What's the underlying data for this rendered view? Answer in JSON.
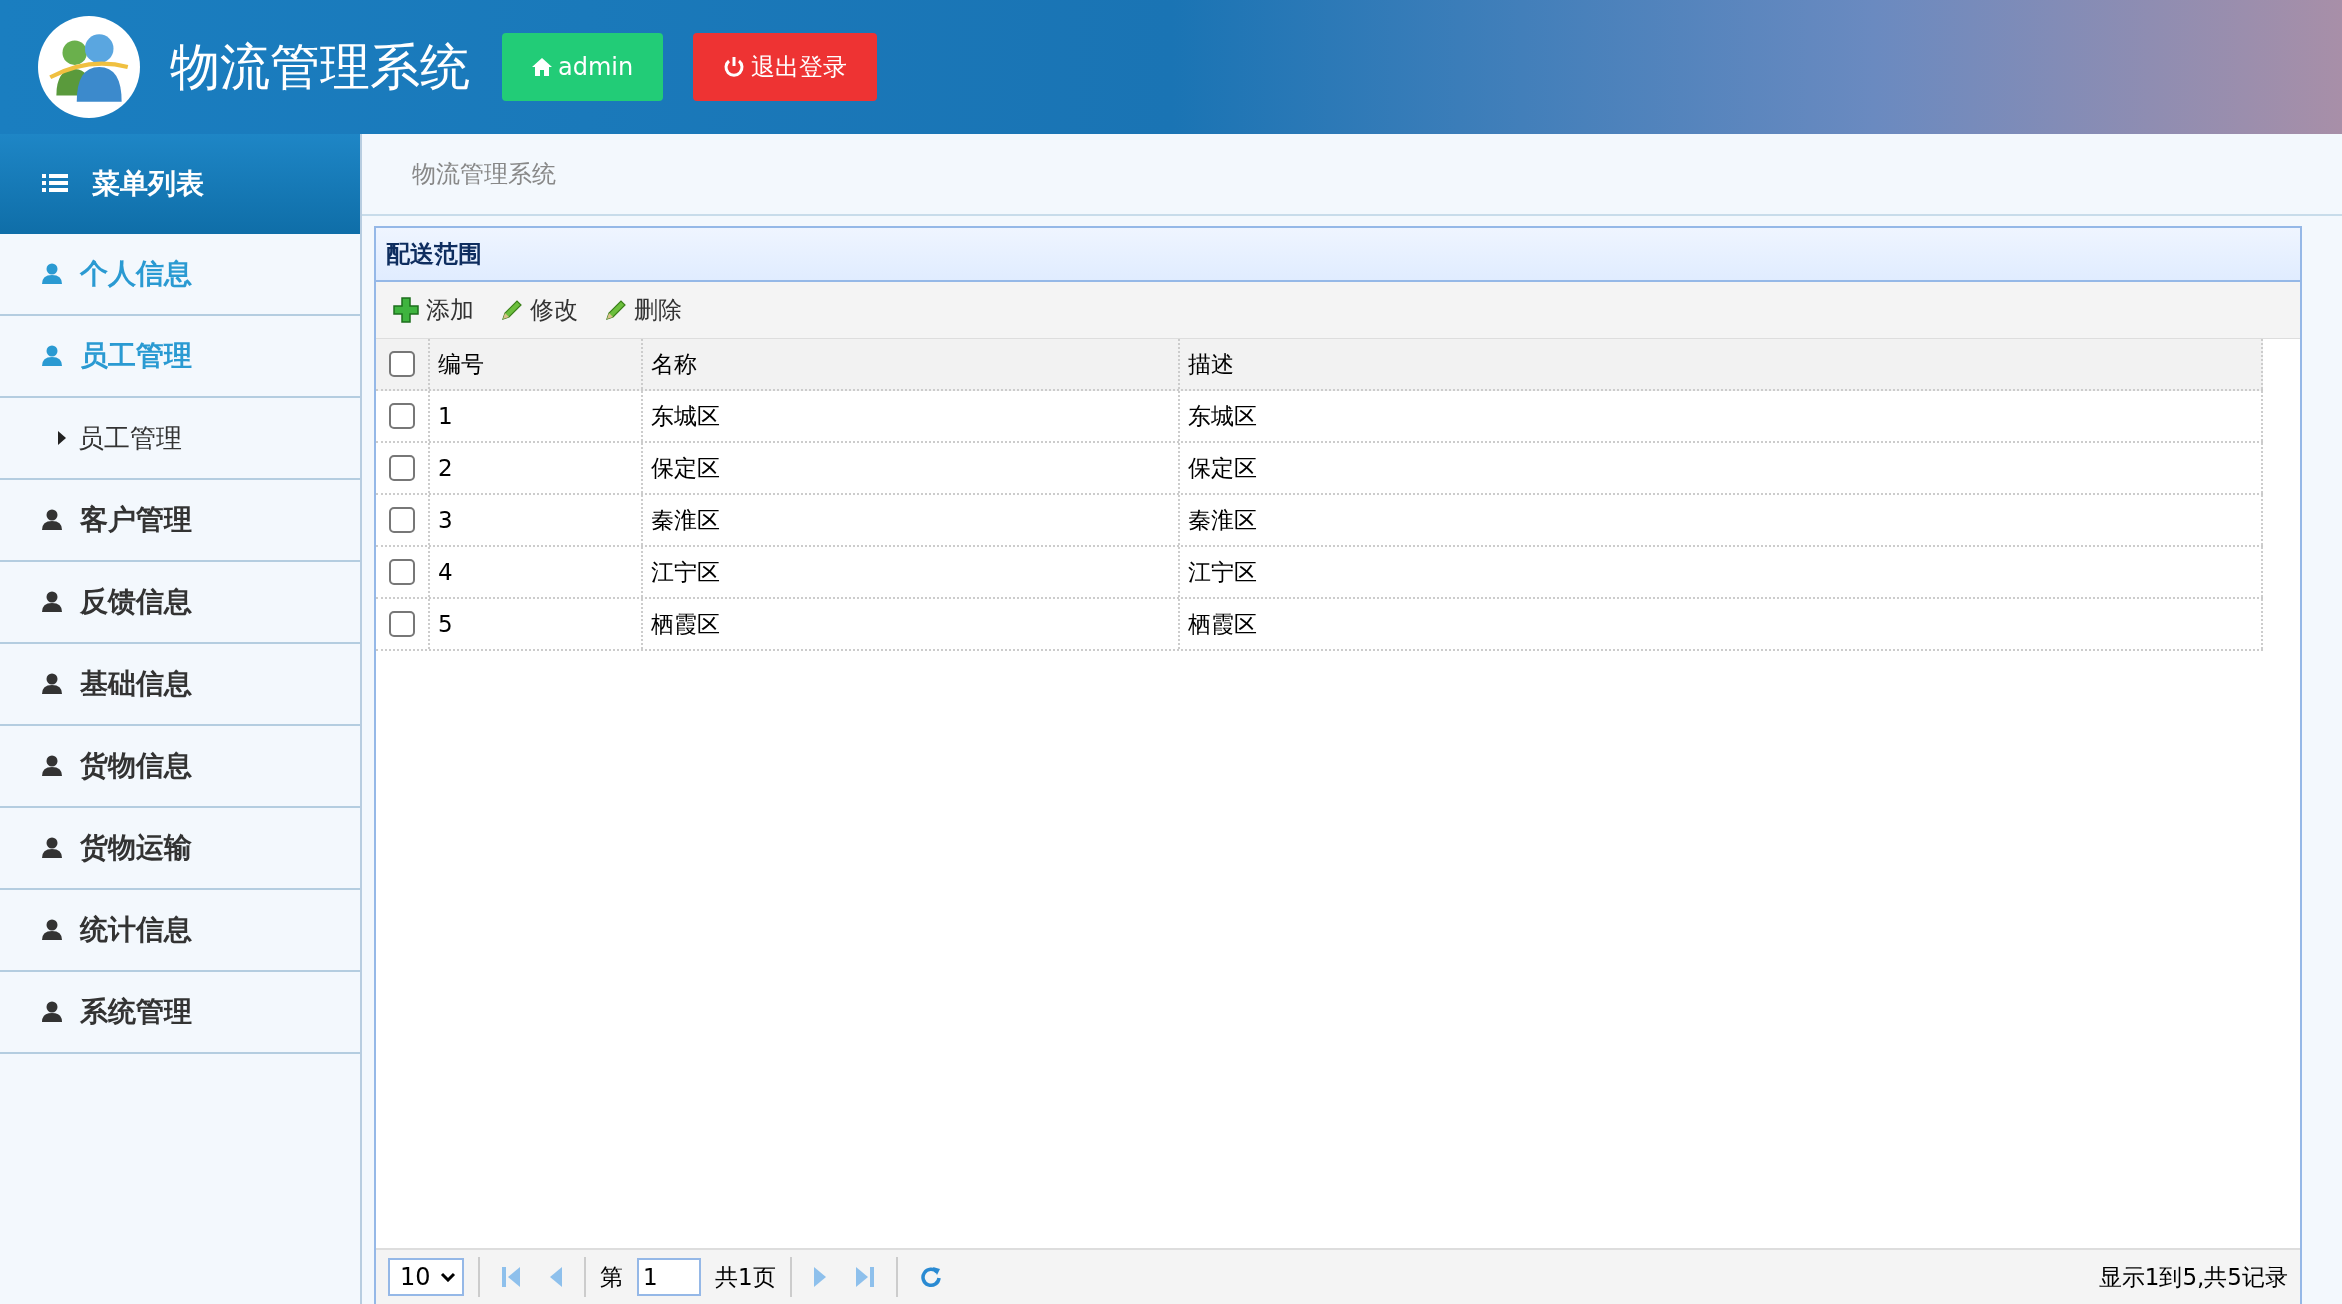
{
  "header": {
    "title": "物流管理系统",
    "user_button": "admin",
    "logout_button": "退出登录"
  },
  "sidebar": {
    "title": "菜单列表",
    "items": [
      {
        "label": "个人信息",
        "active": true
      },
      {
        "label": "员工管理",
        "active": true,
        "expanded": true,
        "children": [
          {
            "label": "员工管理"
          }
        ]
      },
      {
        "label": "客户管理",
        "active": false
      },
      {
        "label": "反馈信息",
        "active": false
      },
      {
        "label": "基础信息",
        "active": false
      },
      {
        "label": "货物信息",
        "active": false
      },
      {
        "label": "货物运输",
        "active": false
      },
      {
        "label": "统计信息",
        "active": false
      },
      {
        "label": "系统管理",
        "active": false
      }
    ]
  },
  "breadcrumb": "物流管理系统",
  "panel": {
    "title": "配送范围",
    "toolbar": [
      {
        "kind": "add",
        "label": "添加"
      },
      {
        "kind": "edit",
        "label": "修改"
      },
      {
        "kind": "edit",
        "label": "删除"
      }
    ],
    "table": {
      "columns": [
        "编号",
        "名称",
        "描述"
      ],
      "header_checked": false,
      "rows": [
        {
          "checked": false,
          "cells": [
            "1",
            "东城区",
            "东城区"
          ]
        },
        {
          "checked": false,
          "cells": [
            "2",
            "保定区",
            "保定区"
          ]
        },
        {
          "checked": false,
          "cells": [
            "3",
            "秦淮区",
            "秦淮区"
          ]
        },
        {
          "checked": false,
          "cells": [
            "4",
            "江宁区",
            "江宁区"
          ]
        },
        {
          "checked": false,
          "cells": [
            "5",
            "栖霞区",
            "栖霞区"
          ]
        }
      ]
    },
    "pager": {
      "page_size": "10",
      "page_label": "第",
      "page": "1",
      "total_pages": "共1页",
      "summary": "显示1到5,共5记录"
    }
  }
}
